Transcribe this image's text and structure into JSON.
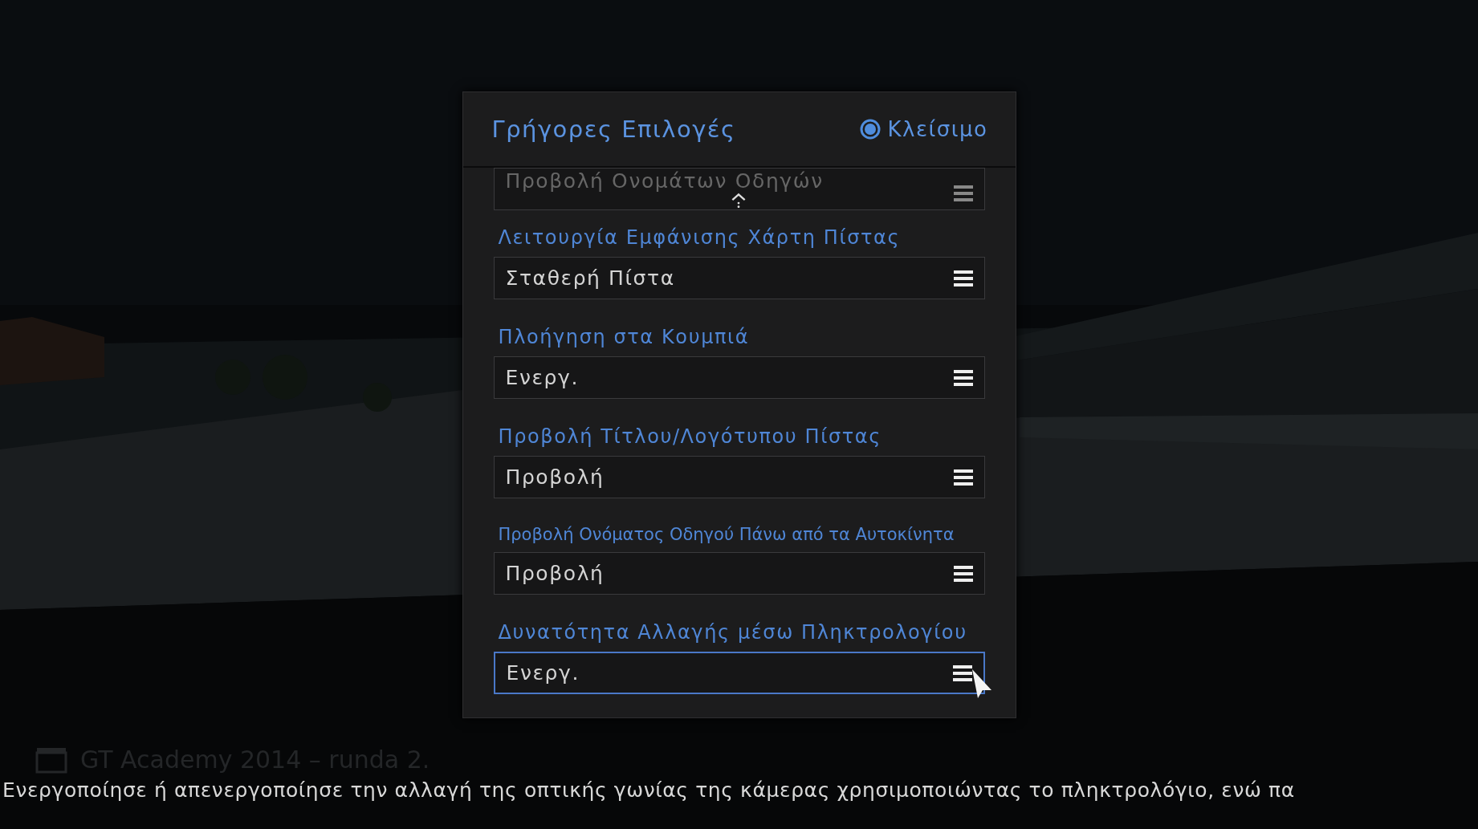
{
  "dialog": {
    "title": "Γρήγορες Επιλογές",
    "close_label": "Κλείσιμο",
    "items": [
      {
        "kind": "scrolled",
        "value": "Προβολή Ονομάτων Οδηγών",
        "selected": false
      },
      {
        "kind": "option",
        "label": "Λειτουργία Εμφάνισης Χάρτη Πίστας",
        "value": "Σταθερή Πίστα",
        "selected": false
      },
      {
        "kind": "option",
        "label": "Πλοήγηση στα Κουμπιά",
        "value": "Ενεργ.",
        "selected": false
      },
      {
        "kind": "option",
        "label": "Προβολή Τίτλου/Λογότυπου Πίστας",
        "value": "Προβολή",
        "selected": false
      },
      {
        "kind": "option",
        "label": "Προβολή Ονόματος Οδηγού Πάνω από τα Αυτοκίνητα",
        "value": "Προβολή",
        "selected": false
      },
      {
        "kind": "option",
        "label": "Δυνατότητα Αλλαγής μέσω Πληκτρολογίου",
        "value": "Ενεργ.",
        "selected": true
      }
    ]
  },
  "replay_title": "GT Academy 2014 – runda 2.",
  "help_text": "Ενεργοποίησε ή απενεργοποίησε την αλλαγή της οπτικής γωνίας της κάμερας χρησιμοποιώντας το πληκτρολόγιο, ενώ πα"
}
